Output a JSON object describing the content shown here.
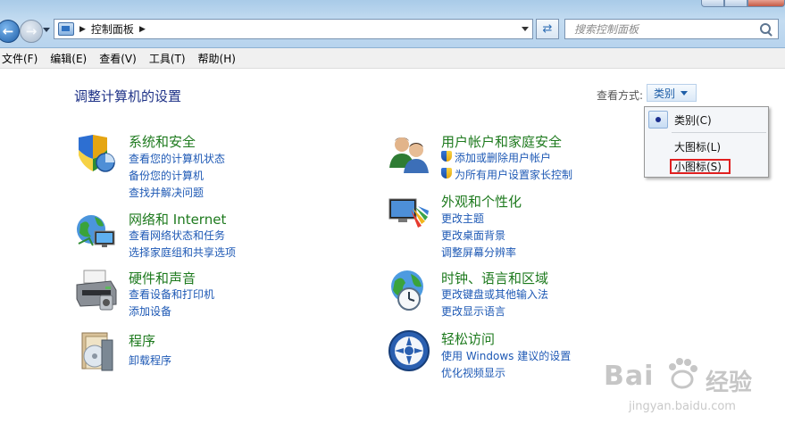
{
  "address": {
    "crumb": "控制面板"
  },
  "search": {
    "placeholder": "搜索控制面板"
  },
  "menu": [
    "文件(F)",
    "编辑(E)",
    "查看(V)",
    "工具(T)",
    "帮助(H)"
  ],
  "page": {
    "title": "调整计算机的设置",
    "view_by_label": "查看方式:",
    "view_by_value": "类别"
  },
  "categories": {
    "system": {
      "title": "系统和安全",
      "links": [
        "查看您的计算机状态",
        "备份您的计算机",
        "查找并解决问题"
      ]
    },
    "network": {
      "title": "网络和 Internet",
      "links": [
        "查看网络状态和任务",
        "选择家庭组和共享选项"
      ]
    },
    "hardware": {
      "title": "硬件和声音",
      "links": [
        "查看设备和打印机",
        "添加设备"
      ]
    },
    "programs": {
      "title": "程序",
      "links": [
        "卸载程序"
      ]
    },
    "users": {
      "title": "用户帐户和家庭安全",
      "links": [
        "添加或删除用户帐户",
        "为所有用户设置家长控制"
      ]
    },
    "appearance": {
      "title": "外观和个性化",
      "links": [
        "更改主题",
        "更改桌面背景",
        "调整屏幕分辨率"
      ]
    },
    "clock": {
      "title": "时钟、语言和区域",
      "links": [
        "更改键盘或其他输入法",
        "更改显示语言"
      ]
    },
    "ease": {
      "title": "轻松访问",
      "links": [
        "使用 Windows 建议的设置",
        "优化视频显示"
      ]
    }
  },
  "view_menu": {
    "category": "类别(C)",
    "large_icons": "大图标(L)",
    "small_icons": "小图标(S)"
  },
  "watermark": {
    "brand": "Bai",
    "brand_cn": "经验",
    "url": "jingyan.baidu.com"
  }
}
